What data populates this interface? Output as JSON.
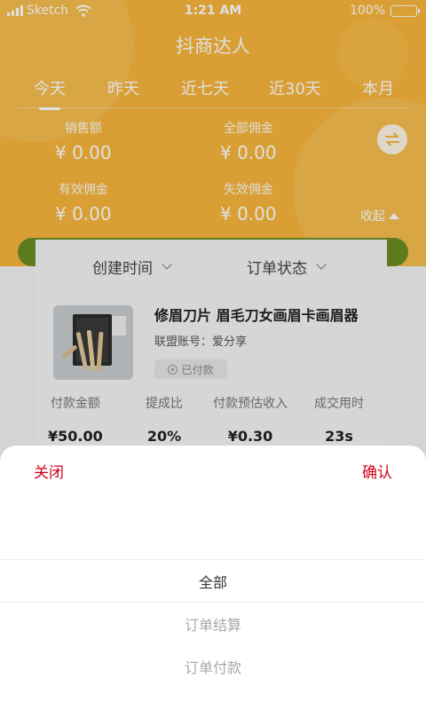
{
  "status_bar": {
    "carrier": "Sketch",
    "time": "1:21 AM",
    "battery": "100%"
  },
  "app": {
    "title": "抖商达人"
  },
  "tabs": [
    {
      "label": "今天",
      "active": true
    },
    {
      "label": "昨天",
      "active": false
    },
    {
      "label": "近七天",
      "active": false
    },
    {
      "label": "近30天",
      "active": false
    },
    {
      "label": "本月",
      "active": false
    }
  ],
  "stats": {
    "sales": {
      "label": "销售额",
      "value": "¥ 0.00"
    },
    "total_commission": {
      "label": "全部佣金",
      "value": "¥ 0.00"
    },
    "valid_commission": {
      "label": "有效佣金",
      "value": "¥ 0.00"
    },
    "invalid_commission": {
      "label": "失效佣金",
      "value": "¥ 0.00"
    }
  },
  "collapse_label": "收起",
  "filters": {
    "create_time": "创建时间",
    "order_status": "订单状态"
  },
  "order": {
    "title": "修眉刀片 眉毛刀女画眉卡画眉器",
    "account": "联盟账号：爱分享",
    "status_badge": "已付款",
    "metrics": [
      {
        "label": "付款金额",
        "value": "¥50.00"
      },
      {
        "label": "提成比",
        "value": "20%"
      },
      {
        "label": "付款预估收入",
        "value": "¥0.30"
      },
      {
        "label": "成交用时",
        "value": "23s"
      }
    ]
  },
  "sheet": {
    "close_label": "关闭",
    "confirm_label": "确认",
    "options": [
      "全部",
      "订单结算",
      "订单付款"
    ],
    "selected_index": 0
  },
  "colors": {
    "header_bg": "#f7b63c",
    "accent_red": "#d0021b",
    "rail_green": "#6b8e23"
  },
  "icons": [
    "signal-icon",
    "wifi-icon",
    "battery-icon",
    "swap-icon",
    "chevron-down-icon",
    "triangle-up-icon",
    "radio-dot-icon"
  ]
}
